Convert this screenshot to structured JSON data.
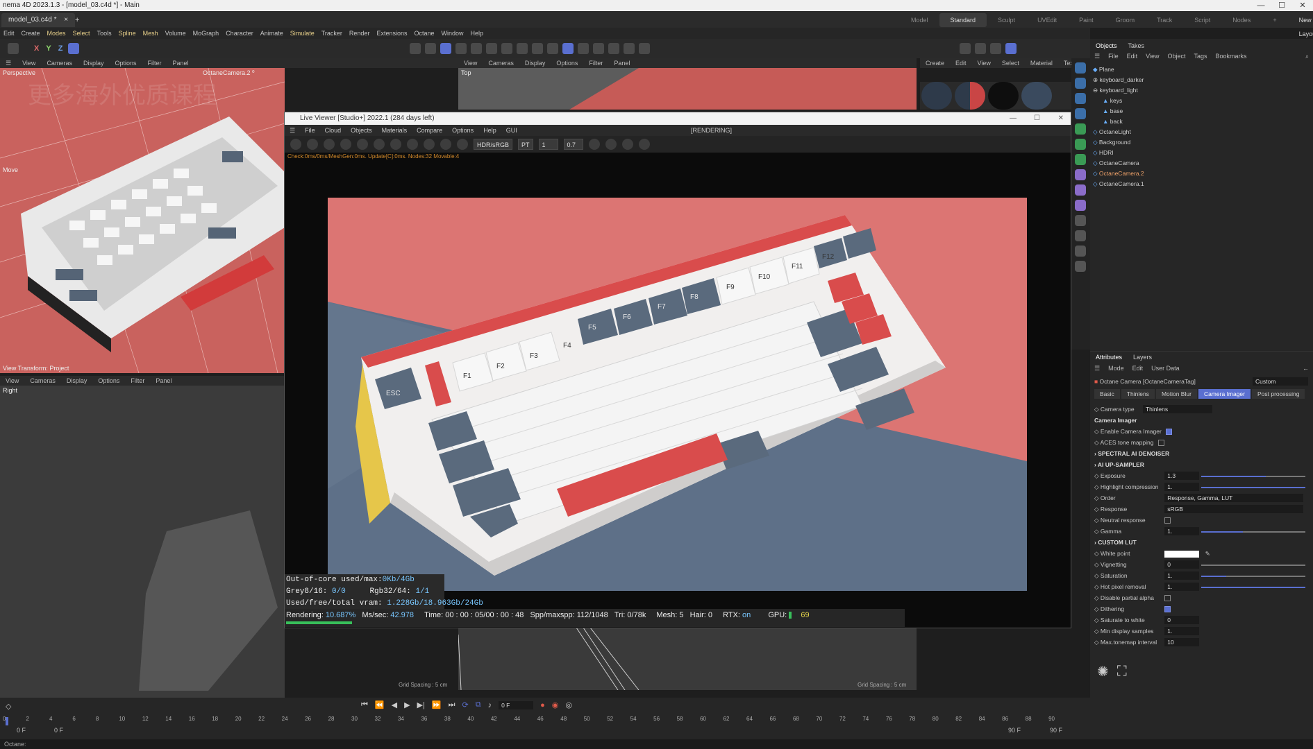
{
  "window": {
    "title": "nema 4D 2023.1.3 - [model_03.c4d *] - Main",
    "controls": [
      "—",
      "☐",
      "✕"
    ]
  },
  "tabs": {
    "doc_tab": "model_03.c4d *",
    "add_tab": "+",
    "layouts": [
      "Model",
      "Standard",
      "Sculpt",
      "UVEdit",
      "Paint",
      "Groom",
      "Track",
      "Script",
      "Nodes",
      "+",
      "New Layouts"
    ],
    "active_layout": "Standard"
  },
  "menubar": [
    "Edit",
    "Create",
    "Modes",
    "Select",
    "Tools",
    "Spline",
    "Mesh",
    "Volume",
    "MoGraph",
    "Character",
    "Animate",
    "Simulate",
    "Tracker",
    "Render",
    "Extensions",
    "Octane",
    "Window",
    "Help"
  ],
  "axis_buttons": [
    "X",
    "Y",
    "Z"
  ],
  "viewports": {
    "menu": [
      "View",
      "Cameras",
      "Display",
      "Options",
      "Filter",
      "Panel"
    ],
    "top_menu_extra": [
      "View",
      "Cameras",
      "Display",
      "Options",
      "Filter",
      "Panel"
    ],
    "perspective_label": "Perspective",
    "camera_label": "OctaneCamera.2 ⁰",
    "move_label": "Move",
    "view_transform": "View Transform: Project",
    "right_label": "Right",
    "top_label": "Top",
    "grid_spacing_left": "Grid Spacing : 5 cm",
    "grid_spacing_right": "Grid Spacing : 5 cm",
    "watermark": "更多海外优质课程"
  },
  "material_menu": [
    "Create",
    "Edit",
    "View",
    "Select",
    "Material",
    "Texture"
  ],
  "live_viewer": {
    "title": "Live Viewer [Studio+] 2022.1 (284 days left)",
    "menu": [
      "File",
      "Cloud",
      "Objects",
      "Materials",
      "Compare",
      "Options",
      "Help",
      "GUI"
    ],
    "rendering_tag": "[RENDERING]",
    "color_space": "HDR/sRGB",
    "kernel": "PT",
    "field_a": "1",
    "field_b": "0.7",
    "check_line": "Check:0ms/0ms/MeshGen:0ms. Update[C]:0ms. Nodes:32 Movable:4",
    "stats": {
      "out_of_core_label": "Out-of-core used/max:",
      "out_of_core_val": "0Kb/4Gb",
      "grey_label": "Grey8/16:",
      "grey_val": "0/0",
      "rgb_label": "Rgb32/64:",
      "rgb_val": "1/1",
      "vram_label": "Used/free/total vram:",
      "vram_val": "1.228Gb/18.963Gb/24Gb"
    },
    "render": {
      "rendering_label": "Rendering:",
      "rendering_val": "10.687%",
      "mssec_label": "Ms/sec:",
      "mssec_val": "42.978",
      "time_label": "Time:",
      "time_val": "00 : 00 : 05/00 : 00 : 48",
      "spp_label": "Spp/maxspp:",
      "spp_val": "112/1048",
      "tri_label": "Tri:",
      "tri_val": "0/78k",
      "mesh_label": "Mesh:",
      "mesh_val": "5",
      "hair_label": "Hair:",
      "hair_val": "0",
      "rtx_label": "RTX:",
      "rtx_val": "on",
      "gpu_label": "GPU:",
      "gpu_val": "69",
      "progress": 0.10687
    },
    "keys": {
      "esc": "ESC",
      "f": [
        "F1",
        "F2",
        "F3",
        "F4",
        "F5",
        "F6",
        "F7",
        "F8",
        "F9",
        "F10",
        "F11",
        "F12"
      ]
    }
  },
  "objects_panel": {
    "tabs": [
      "Objects",
      "Takes"
    ],
    "menu": [
      "File",
      "Edit",
      "View",
      "Object",
      "Tags",
      "Bookmarks"
    ],
    "items": [
      {
        "name": "Plane",
        "indent": 0,
        "selected": false
      },
      {
        "name": "keyboard_darker",
        "indent": 0,
        "selected": false
      },
      {
        "name": "keyboard_light",
        "indent": 0,
        "selected": false
      },
      {
        "name": "keys",
        "indent": 1,
        "selected": false
      },
      {
        "name": "base",
        "indent": 1,
        "selected": false
      },
      {
        "name": "back",
        "indent": 1,
        "selected": false
      },
      {
        "name": "OctaneLight",
        "indent": 0,
        "selected": false
      },
      {
        "name": "Background",
        "indent": 0,
        "selected": false
      },
      {
        "name": "HDRI",
        "indent": 0,
        "selected": false
      },
      {
        "name": "OctaneCamera",
        "indent": 0,
        "selected": false
      },
      {
        "name": "OctaneCamera.2",
        "indent": 0,
        "selected": true
      },
      {
        "name": "OctaneCamera.1",
        "indent": 0,
        "selected": false
      }
    ]
  },
  "attributes_panel": {
    "tabs": [
      "Attributes",
      "Layers"
    ],
    "menu": [
      "Mode",
      "Edit",
      "User Data"
    ],
    "object_title": "Octane Camera [OctaneCameraTag]",
    "preset": "Custom",
    "subtabs": [
      "Basic",
      "Thinlens",
      "Motion Blur",
      "Camera Imager",
      "Post processing"
    ],
    "active_subtab": "Camera Imager",
    "camera_type_label": "Camera type",
    "camera_type_val": "Thinlens",
    "section": "Camera Imager",
    "enable_label": "Enable Camera Imager",
    "enable_on": true,
    "aces_label": "ACES tone mapping",
    "aces_on": false,
    "groups": [
      "SPECTRAL AI DENOISER",
      "AI UP-SAMPLER"
    ],
    "params": [
      {
        "label": "Exposure",
        "value": "1.3",
        "fill": 0.62
      },
      {
        "label": "Highlight compression",
        "value": "1.",
        "fill": 1.0
      }
    ],
    "order_label": "Order",
    "order_val": "Response, Gamma, LUT",
    "response_label": "Response",
    "response_val": "sRGB",
    "neutral_label": "Neutral response",
    "gamma_label": "Gamma",
    "gamma_val": "1.",
    "gamma_fill": 0.4,
    "custom_lut": "CUSTOM LUT",
    "params2": [
      {
        "label": "White point",
        "value": ""
      },
      {
        "label": "Vignetting",
        "value": "0",
        "fill": 0.0
      },
      {
        "label": "Saturation",
        "value": "1.",
        "fill": 0.24
      },
      {
        "label": "Hot pixel removal",
        "value": "1.",
        "fill": 1.0
      }
    ],
    "disable_alpha_label": "Disable partial alpha",
    "dithering_label": "Dithering",
    "saturate_label": "Saturate to white",
    "saturate_val": "0",
    "min_samples_label": "Min display samples",
    "min_samples_val": "1.",
    "max_interval_label": "Max.tonemap interval",
    "max_interval_val": "10"
  },
  "timeline": {
    "frame": "0 F",
    "start": "0 F",
    "start2": "0 F",
    "end": "90 F",
    "end2": "90 F",
    "ticks": [
      "0",
      "2",
      "4",
      "6",
      "8",
      "10",
      "12",
      "14",
      "16",
      "18",
      "20",
      "22",
      "24",
      "26",
      "28",
      "30",
      "32",
      "34",
      "36",
      "38",
      "40",
      "42",
      "44",
      "46",
      "48",
      "50",
      "52",
      "54",
      "56",
      "58",
      "60",
      "62",
      "64",
      "66",
      "68",
      "70",
      "72",
      "74",
      "76",
      "78",
      "80",
      "82",
      "84",
      "86",
      "88",
      "90"
    ]
  },
  "status": "Octane:"
}
